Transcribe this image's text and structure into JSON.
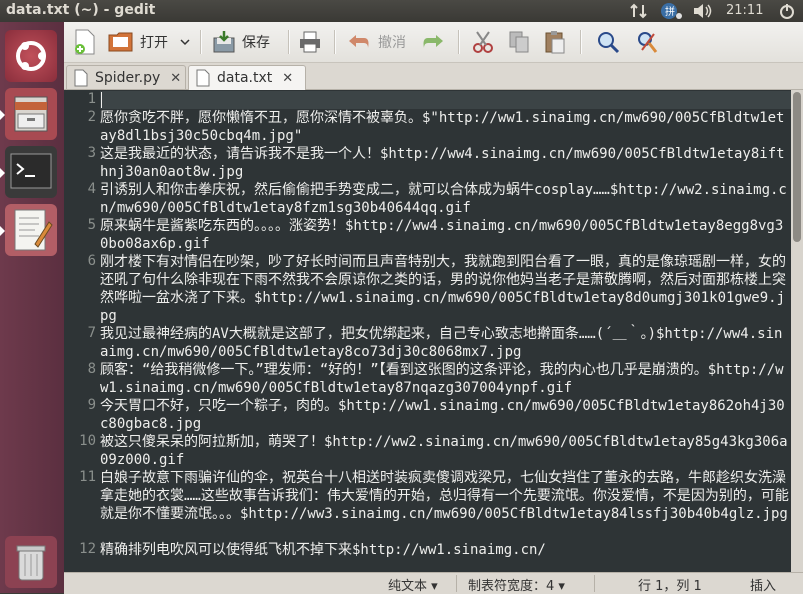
{
  "window": {
    "title": "data.txt (~) - gedit"
  },
  "panel": {
    "clock": "21:11"
  },
  "launcher": {
    "items": [
      {
        "name": "dash-home-icon"
      },
      {
        "name": "files-icon"
      },
      {
        "name": "terminal-icon"
      },
      {
        "name": "text-editor-icon"
      },
      {
        "name": "trash-icon"
      }
    ]
  },
  "toolbar": {
    "new": "新建",
    "open_label": "打开",
    "save_label": "保存",
    "undo_label": "撤消"
  },
  "tabs": [
    {
      "label": "Spider.py",
      "active": false
    },
    {
      "label": "data.txt",
      "active": true
    }
  ],
  "document": {
    "lines": [
      {
        "num": "1",
        "text": ""
      },
      {
        "num": "2",
        "text": "愿你贪吃不胖，愿你懒惰不丑，愿你深情不被辜负。$\"http://ww1.sinaimg.cn/mw690/005CfBldtw1etay8dl1bsj30c50cbq4m.jpg\""
      },
      {
        "num": "3",
        "text": "这是我最近的状态，请告诉我不是我一个人！$http://ww4.sinaimg.cn/mw690/005CfBldtw1etay8ifthnj30an0aot8w.jpg"
      },
      {
        "num": "4",
        "text": "引诱别人和你击拳庆祝，然后偷偷把手势变成二，就可以合体成为蜗牛cosplay……$http://ww2.sinaimg.cn/mw690/005CfBldtw1etay8fzm1sg30b40644qq.gif"
      },
      {
        "num": "5",
        "text": "原来蜗牛是酱紫吃东西的。。。。涨姿势！$http://ww4.sinaimg.cn/mw690/005CfBldtw1etay8egg8vg30bo08ax6p.gif"
      },
      {
        "num": "6",
        "text": "刚才楼下有对情侣在吵架，吵了好长时间而且声音特别大，我就跑到阳台看了一眼，真的是像琼瑶剧一样，女的还吼了句什么除非现在下雨不然我不会原谅你之类的话，男的说你他妈当老子是萧敬腾啊，然后对面那栋楼上突然哗啦一盆水浇了下来。$http://ww1.sinaimg.cn/mw690/005CfBldtw1etay8d0umgj301k01gwe9.jpg"
      },
      {
        "num": "7",
        "text": "我见过最神经病的AV大概就是这部了，把女优绑起来，自己专心致志地擀面条……(´＿｀。)$http://ww4.sinaimg.cn/mw690/005CfBldtw1etay8co73dj30c8068mx7.jpg"
      },
      {
        "num": "8",
        "text": "顾客：“给我稍微修一下。”理发师：“好的！”【看到这张图的这条评论，我的内心也几乎是崩溃的。$http://ww1.sinaimg.cn/mw690/005CfBldtw1etay87nqazg307004ynpf.gif"
      },
      {
        "num": "9",
        "text": "今天胃口不好，只吃一个粽子，肉的。$http://ww1.sinaimg.cn/mw690/005CfBldtw1etay862oh4j30c80gbac8.jpg"
      },
      {
        "num": "10",
        "text": "被这只傻呆呆的阿拉斯加，萌哭了！$http://ww2.sinaimg.cn/mw690/005CfBldtw1etay85g43kg306a09z000.gif"
      },
      {
        "num": "11",
        "text": "白娘子故意下雨骗许仙的伞，祝英台十八相送时装疯卖傻调戏梁兄，七仙女挡住了董永的去路，牛郎趁织女洗澡拿走她的衣裳……这些故事告诉我们：伟大爱情的开始，总归得有一个先要流氓。你没爱情，不是因为别的，可能就是你不懂要流氓。。。$http://ww3.sinaimg.cn/mw690/005CfBldtw1etay84lssfj30b40b4glz.jpg"
      },
      {
        "num": "12",
        "text": "精确排列电吹风可以使得纸飞机不掉下来$http://ww1.sinaimg.cn/"
      }
    ]
  },
  "statusbar": {
    "mode": "纯文本",
    "tab_width": "制表符宽度：4",
    "position": "行 1，列 1",
    "insert_mode": "插入"
  }
}
